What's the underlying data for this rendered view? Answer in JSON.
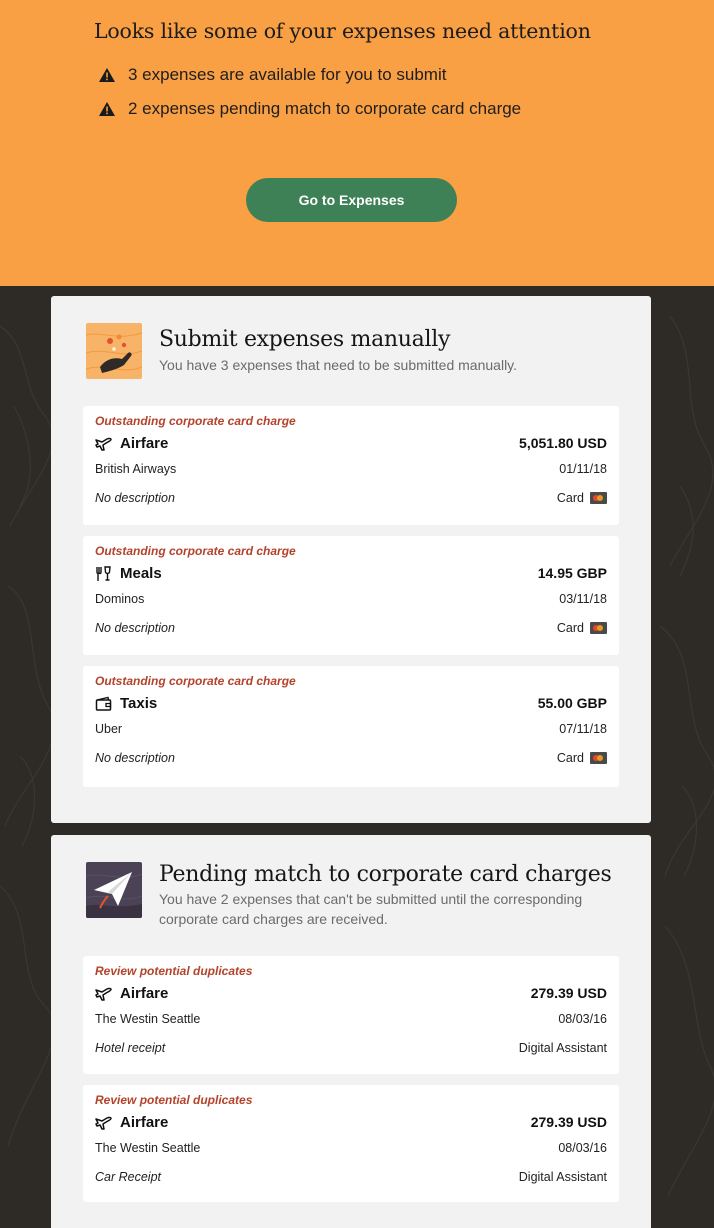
{
  "banner": {
    "title": "Looks like some of your expenses need attention",
    "alerts": [
      "3 expenses are available for you to submit",
      "2 expenses pending match to corporate card charge"
    ],
    "button_label": "Go to Expenses",
    "color": "#f99f44",
    "button_color": "#3e8156"
  },
  "sections": [
    {
      "title": "Submit expenses manually",
      "subtitle": "You have 3 expenses that need to be submitted manually.",
      "icon": "hand-flowers-icon",
      "cards": [
        {
          "flag": "Outstanding corporate card charge",
          "icon": "airplane-icon",
          "category": "Airfare",
          "amount": "5,051.80 USD",
          "merchant": "British Airways",
          "date": "01/11/18",
          "description": "No description",
          "source": "Card"
        },
        {
          "flag": "Outstanding corporate card charge",
          "icon": "utensils-icon",
          "category": "Meals",
          "amount": "14.95 GBP",
          "merchant": "Dominos",
          "date": "03/11/18",
          "description": "No description",
          "source": "Card"
        },
        {
          "flag": "Outstanding corporate card charge",
          "icon": "wallet-icon",
          "category": "Taxis",
          "amount": "55.00 GBP",
          "merchant": "Uber",
          "date": "07/11/18",
          "description": "No description",
          "source": "Card"
        }
      ]
    },
    {
      "title": "Pending match to corporate card charges",
      "subtitle": "You have 2 expenses that can't be submitted until the corresponding corporate card charges are received.",
      "icon": "paper-plane-icon",
      "cards": [
        {
          "flag": "Review potential duplicates",
          "icon": "airplane-icon",
          "category": "Airfare",
          "amount": "279.39 USD",
          "merchant": "The Westin Seattle",
          "date": "08/03/16",
          "description": "Hotel receipt",
          "source": "Digital Assistant"
        },
        {
          "flag": "Review potential duplicates",
          "icon": "airplane-icon",
          "category": "Airfare",
          "amount": "279.39 USD",
          "merchant": "The Westin Seattle",
          "date": "08/03/16",
          "description": "Car Receipt",
          "source": "Digital Assistant"
        }
      ]
    }
  ]
}
